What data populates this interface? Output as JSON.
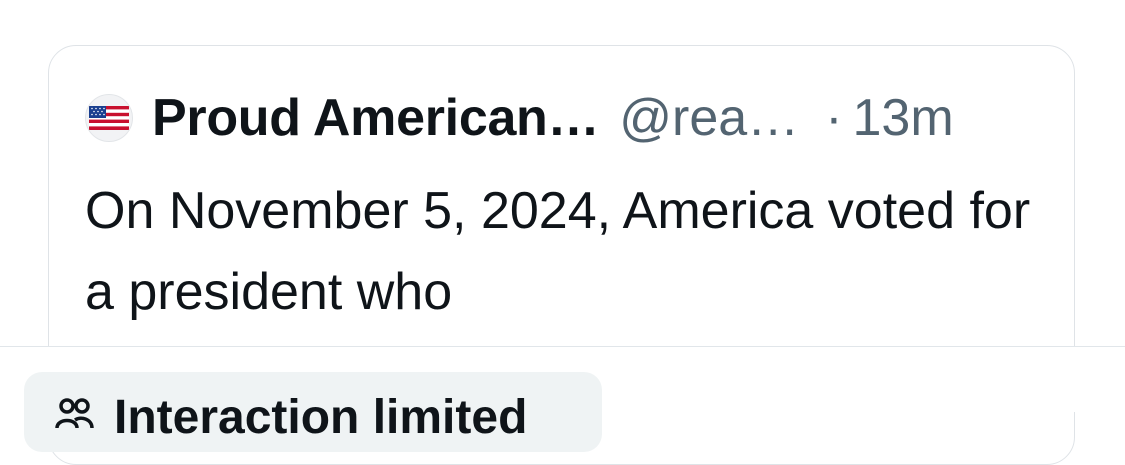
{
  "quote": {
    "author_name": "Proud American…",
    "author_handle": "@rea…",
    "separator": "·",
    "time_ago": "13m",
    "avatar_icon": "us-flag-icon",
    "text": "On November 5, 2024, America voted for a president who"
  },
  "notice": {
    "label": "Interaction limited",
    "icon": "people-icon"
  },
  "colors": {
    "primary_text": "#0f1419",
    "secondary_text": "#536471",
    "border": "#dfe3e7",
    "pill_background": "#eff3f4"
  }
}
